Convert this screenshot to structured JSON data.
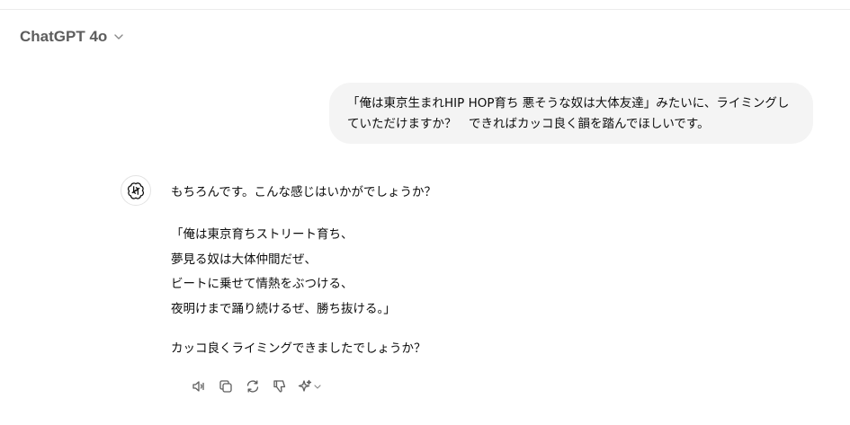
{
  "header": {
    "model_name": "ChatGPT 4o",
    "chevron_icon": "chevron-down-icon"
  },
  "user_message": {
    "lines": [
      "「俺は東京生まれHIP HOP育ち 悪そうな奴は大体友達」みたいに、ライミングし",
      "ていただけますか？　できればカッコ良く韻を踏んでほしいです。"
    ]
  },
  "assistant_message": {
    "avatar_icon": "openai-logo-icon",
    "intro": "もちろんです。こんな感じはいかがでしょうか？",
    "verse": [
      "「俺は東京育ちストリート育ち、",
      "夢見る奴は大体仲間だぜ、",
      "ビートに乗せて情熱をぶつける、",
      "夜明けまで踊り続けるぜ、勝ち抜ける。」"
    ],
    "outro": "カッコ良くライミングできましたでしょうか？"
  },
  "actions": [
    {
      "name": "read-aloud",
      "icon": "speaker-icon"
    },
    {
      "name": "copy",
      "icon": "copy-icon"
    },
    {
      "name": "regenerate",
      "icon": "refresh-icon"
    },
    {
      "name": "bad-response",
      "icon": "thumbs-down-icon"
    },
    {
      "name": "switch-model",
      "icon": "sparkle-icon"
    }
  ],
  "colors": {
    "bubble": "#f4f4f4",
    "text": "#0d0d0d",
    "muted": "#5d5d5d",
    "icon": "#5d5d5d"
  }
}
